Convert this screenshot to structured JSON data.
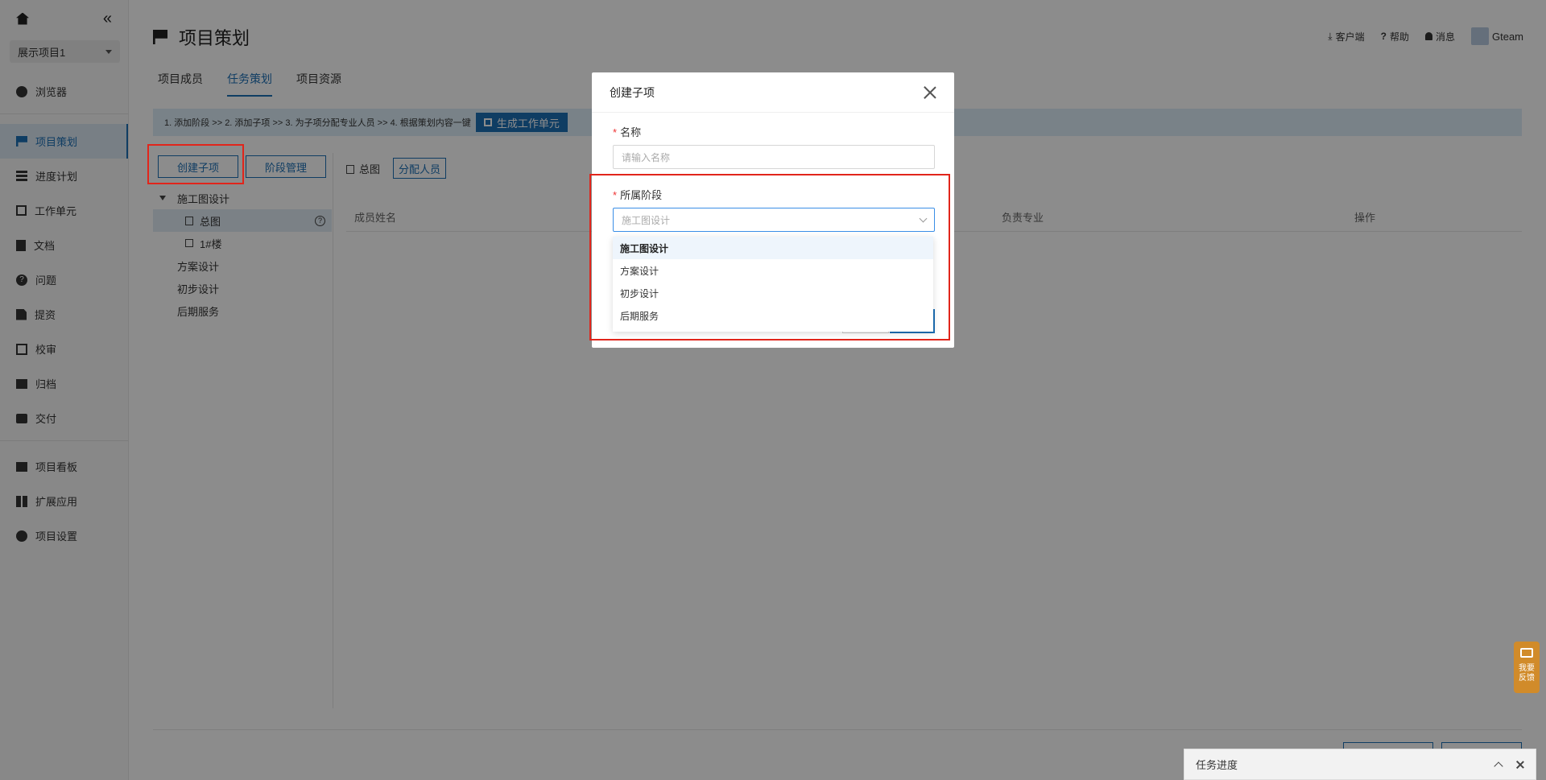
{
  "sidebar": {
    "project": "展示项目1",
    "items": [
      {
        "label": "浏览器",
        "icon": "globe-icon"
      },
      {
        "label": "项目策划",
        "icon": "flag-icon",
        "active": true
      },
      {
        "label": "进度计划",
        "icon": "gantt-icon"
      },
      {
        "label": "工作单元",
        "icon": "cube-icon"
      },
      {
        "label": "文档",
        "icon": "document-icon"
      },
      {
        "label": "问题",
        "icon": "question-icon"
      },
      {
        "label": "提资",
        "icon": "upload-icon"
      },
      {
        "label": "校审",
        "icon": "review-icon"
      },
      {
        "label": "归档",
        "icon": "archive-icon"
      },
      {
        "label": "交付",
        "icon": "briefcase-icon"
      },
      {
        "label": "项目看板",
        "icon": "dashboard-icon"
      },
      {
        "label": "扩展应用",
        "icon": "apps-icon"
      },
      {
        "label": "项目设置",
        "icon": "gear-icon"
      }
    ]
  },
  "header": {
    "title": "项目策划",
    "client": "客户端",
    "help": "帮助",
    "messages": "消息",
    "user": "Gteam"
  },
  "tabs": [
    "项目成员",
    "任务策划",
    "项目资源"
  ],
  "stepbar": {
    "text": "1. 添加阶段  >>  2. 添加子项  >>  3. 为子项分配专业人员  >>  4. 根据策划内容一键",
    "generate": "生成工作单元"
  },
  "left": {
    "create_sub": "创建子项",
    "stage_manage": "阶段管理",
    "tree": [
      {
        "label": "施工图设计",
        "level": 0,
        "expanded": true
      },
      {
        "label": "总图",
        "level": 1,
        "selected": true
      },
      {
        "label": "1#楼",
        "level": 1
      },
      {
        "label": "方案设计",
        "level": 0
      },
      {
        "label": "初步设计",
        "level": 0
      },
      {
        "label": "后期服务",
        "level": 0
      }
    ]
  },
  "main": {
    "crumb": "总图",
    "assign": "分配人员",
    "columns": [
      "成员姓名",
      "负责专业",
      "操作"
    ]
  },
  "modal": {
    "title": "创建子项",
    "name_label": "名称",
    "name_placeholder": "请输入名称",
    "stage_label": "所属阶段",
    "stage_value": "施工图设计",
    "options": [
      "施工图设计",
      "方案设计",
      "初步设计",
      "后期服务"
    ]
  },
  "task_panel": {
    "title": "任务进度"
  },
  "feedback": {
    "line1": "我要",
    "line2": "反馈"
  },
  "colors": {
    "accent": "#1d6fb5",
    "highlight": "#e1251b",
    "feedback": "#d18b2a"
  }
}
